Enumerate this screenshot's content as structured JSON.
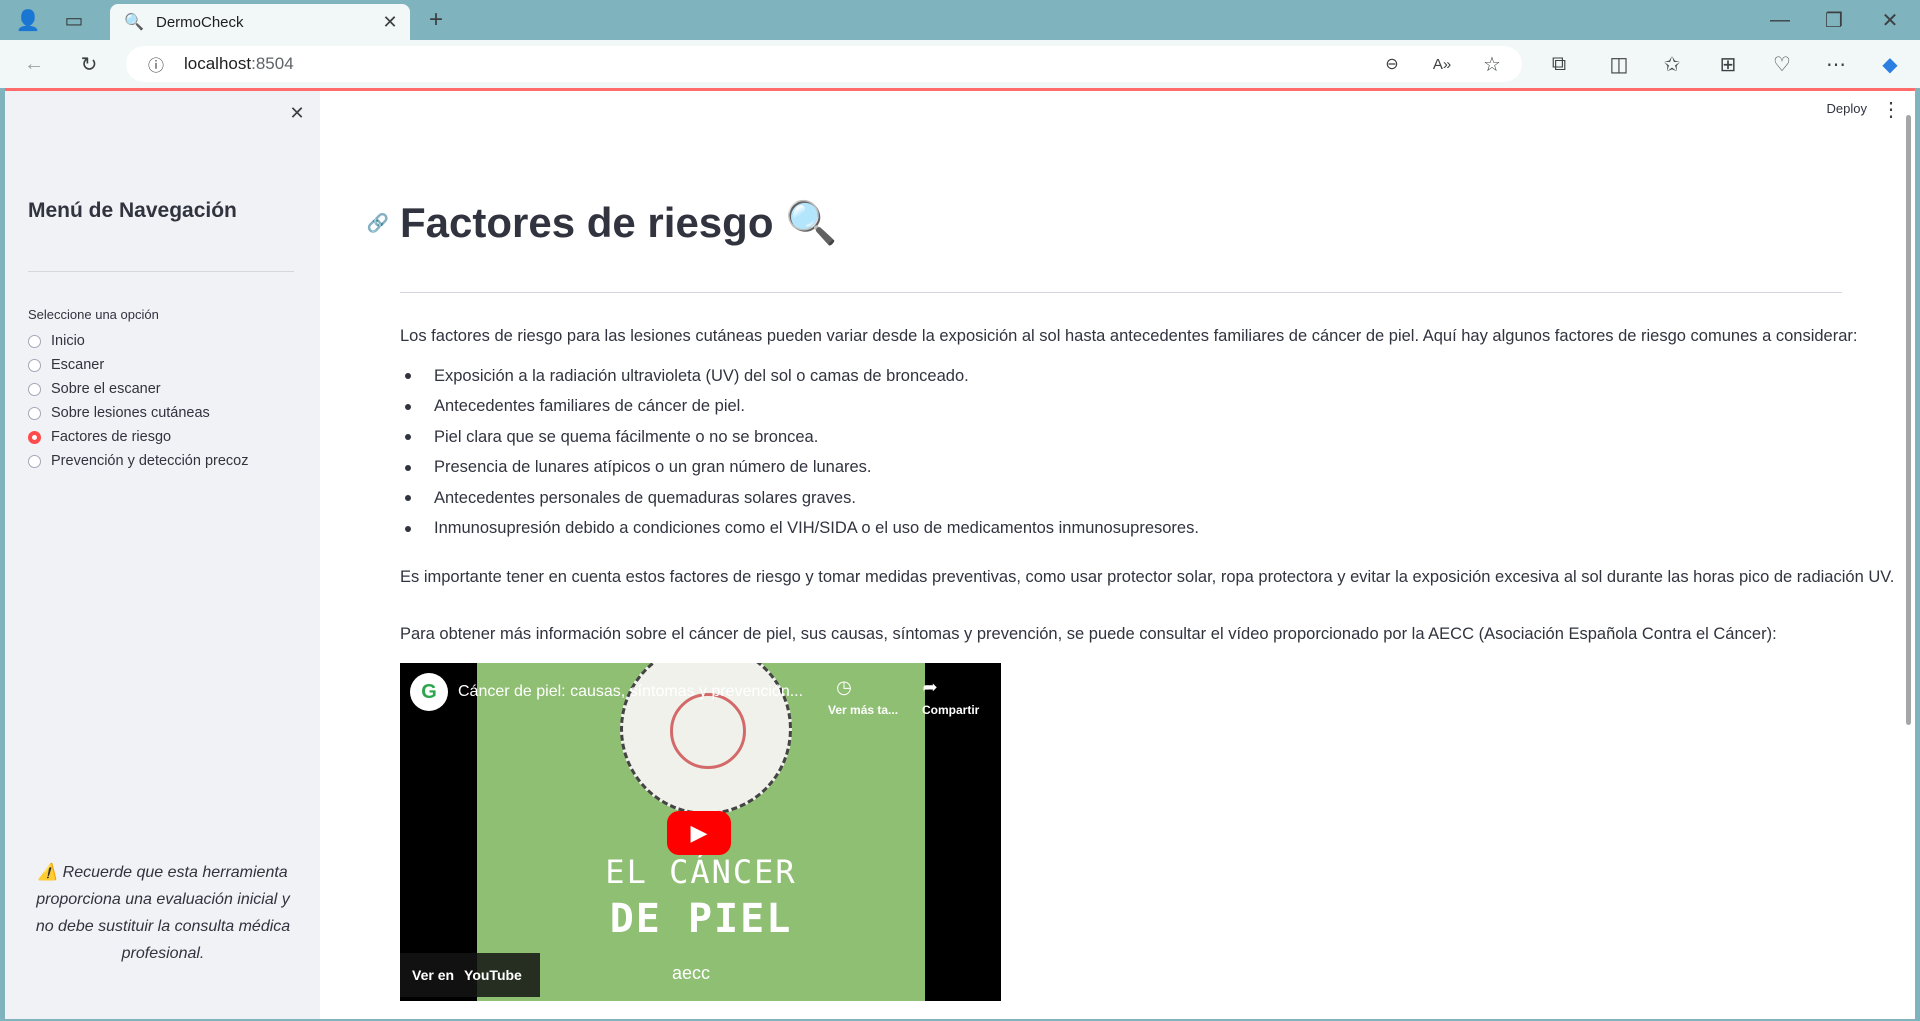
{
  "browser": {
    "tab_title": "DermoCheck",
    "url_host": "localhost",
    "url_port": ":8504"
  },
  "app": {
    "deploy_label": "Deploy"
  },
  "sidebar": {
    "title": "Menú de Navegación",
    "radio_label": "Seleccione una opción",
    "options": [
      "Inicio",
      "Escaner",
      "Sobre el escaner",
      "Sobre lesiones cutáneas",
      "Factores de riesgo",
      "Prevención y detección precoz"
    ],
    "selected": "Factores de riesgo",
    "note": "⚠️ Recuerde que esta herramienta proporciona una evaluación inicial y no debe sustituir la consulta médica profesional."
  },
  "main": {
    "title": "Factores de riesgo 🔍",
    "intro": "Los factores de riesgo para las lesiones cutáneas pueden variar desde la exposición al sol hasta antecedentes familiares de cáncer de piel. Aquí hay algunos factores de riesgo comunes a considerar:",
    "bullets": [
      "Exposición a la radiación ultravioleta (UV) del sol o camas de bronceado.",
      "Antecedentes familiares de cáncer de piel.",
      "Piel clara que se quema fácilmente o no se broncea.",
      "Presencia de lunares atípicos o un gran número de lunares.",
      "Antecedentes personales de quemaduras solares graves.",
      "Inmunosupresión debido a condiciones como el VIH/SIDA o el uso de medicamentos inmunosupresores."
    ],
    "para2": "Es importante tener en cuenta estos factores de riesgo y tomar medidas preventivas, como usar protector solar, ropa protectora y evitar la exposición excesiva al sol durante las horas pico de radiación UV.",
    "para3": "Para obtener más información sobre el cáncer de piel, sus causas, síntomas y prevención, se puede consultar el vídeo proporcionado por la AECC (Asociación Española Contra el Cáncer):",
    "video": {
      "title": "Cáncer de piel: causas, síntomas y prevención...",
      "watch_later": "Ver más ta...",
      "share": "Compartir",
      "text1": "EL CÁNCER",
      "text2": "DE PIEL",
      "brand": "aecc",
      "watch_on": "Ver en",
      "youtube": "YouTube"
    }
  }
}
